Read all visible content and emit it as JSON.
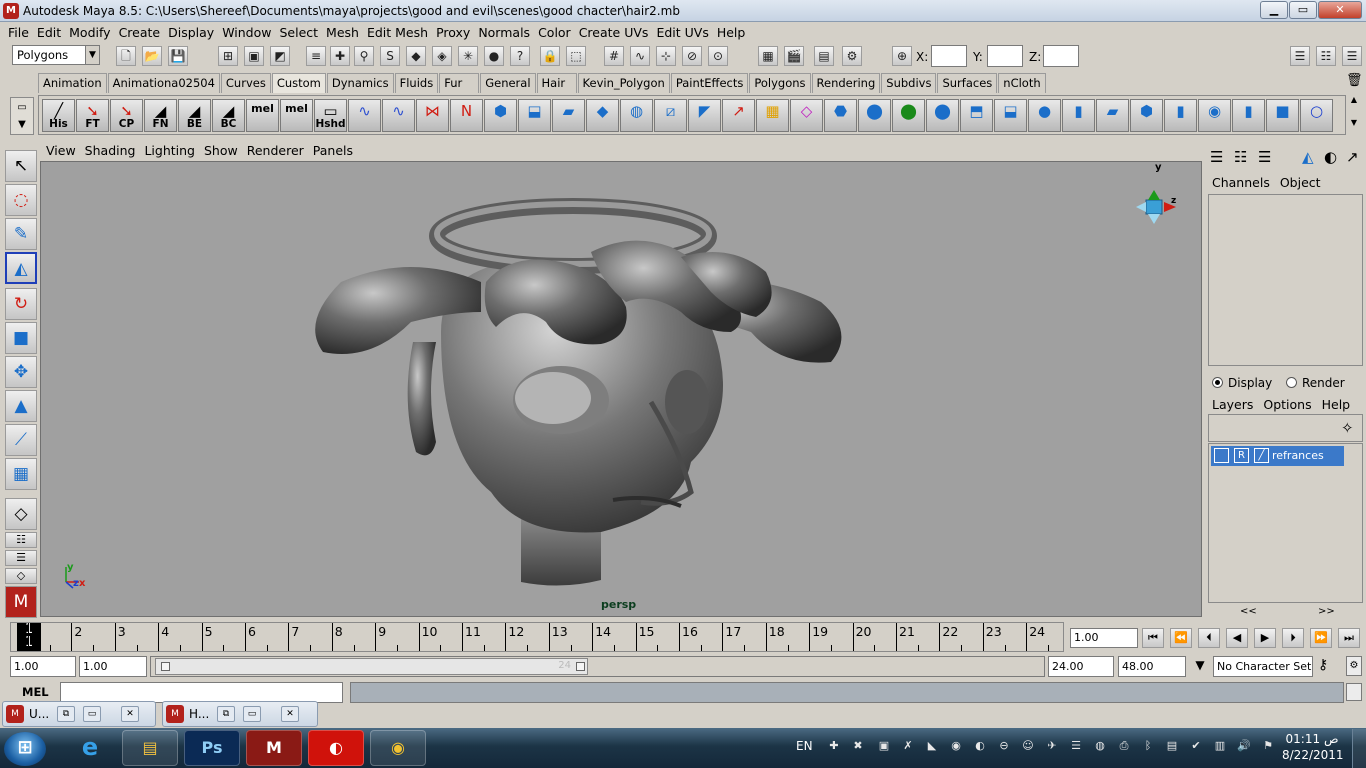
{
  "window": {
    "title": "Autodesk Maya 8.5: C:\\Users\\Shereef\\Documents\\maya\\projects\\good and evil\\scenes\\good chacter\\hair2.mb",
    "minimize": "▁",
    "maximize": "▭",
    "close": "✕"
  },
  "menu": [
    "File",
    "Edit",
    "Modify",
    "Create",
    "Display",
    "Window",
    "Select",
    "Mesh",
    "Edit Mesh",
    "Proxy",
    "Normals",
    "Color",
    "Create UVs",
    "Edit UVs",
    "Help"
  ],
  "status_line": {
    "mode": "Polygons",
    "x_label": "X:",
    "y_label": "Y:",
    "z_label": "Z:"
  },
  "shelf_tabs": [
    "Animation",
    "Animationa02504",
    "Curves",
    "Custom",
    "Dynamics",
    "Fluids",
    "Fur",
    "General",
    "Hair",
    "Kevin_Polygon",
    "PaintEffects",
    "Polygons",
    "Rendering",
    "Subdivs",
    "Surfaces",
    "nCloth"
  ],
  "shelf_active_tab": "Custom",
  "shelf_buttons": [
    "His",
    "FT",
    "CP",
    "FN",
    "BE",
    "BC",
    "mel",
    "mel",
    "Hshd"
  ],
  "viewport": {
    "menu": [
      "View",
      "Shading",
      "Lighting",
      "Show",
      "Renderer",
      "Panels"
    ],
    "camera": "persp",
    "axis_x": "x",
    "axis_y": "y",
    "axis_z": "z"
  },
  "channel_box": {
    "tabs": [
      "Channels",
      "Object"
    ]
  },
  "layer_editor": {
    "modes": [
      "Display",
      "Render"
    ],
    "selected_mode": "Display",
    "menu": [
      "Layers",
      "Options",
      "Help"
    ],
    "layers": [
      {
        "visible": "",
        "reference": "R",
        "name": "refrances"
      }
    ],
    "page_prev": "<<",
    "page_next": ">>"
  },
  "time_slider": {
    "ticks": [
      "2",
      "3",
      "4",
      "5",
      "6",
      "7",
      "8",
      "9",
      "10",
      "11",
      "12",
      "13",
      "14",
      "15",
      "16",
      "17",
      "18",
      "19",
      "20",
      "21",
      "22",
      "23",
      "24"
    ],
    "current_frame": "1",
    "current_frame_field": "1.00"
  },
  "range_slider": {
    "start": "1.00",
    "playback_start": "1.00",
    "range_end_label": "24",
    "playback_end": "24.00",
    "end": "48.00",
    "character_set": "No Character Set"
  },
  "command_line": {
    "label": "MEL"
  },
  "minimized_windows": [
    {
      "title": "U..."
    },
    {
      "title": "H..."
    }
  ],
  "taskbar": {
    "language": "EN",
    "time": "01:11 ص",
    "date": "8/22/2011",
    "apps": [
      "ie-icon",
      "explorer-icon",
      "photoshop-icon",
      "maya-icon",
      "vodafone-icon",
      "chrome-icon"
    ]
  },
  "accent_colors": {
    "selection": "#3b79c9",
    "viewport_bg": "#a0a0a0",
    "taskbar": "#1c3446"
  }
}
